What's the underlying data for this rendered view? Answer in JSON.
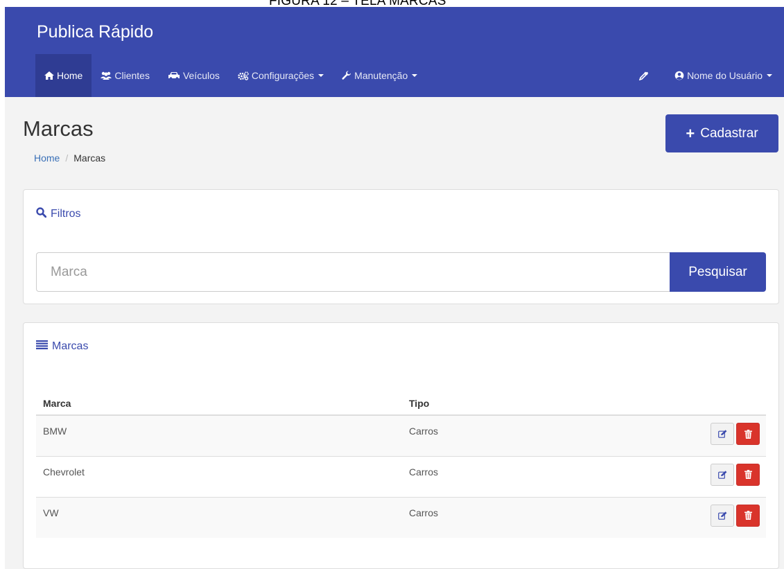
{
  "caption": "FIGURA 12 – TELA MARCAS",
  "app": {
    "brand": "Publica Rápido"
  },
  "nav": {
    "home": "Home",
    "clientes": "Clientes",
    "veiculos": "Veículos",
    "configuracoes": "Configurações",
    "manutencao": "Manutenção",
    "user": "Nome do Usuário"
  },
  "page": {
    "title": "Marcas",
    "breadcrumb": [
      "Home",
      "Marcas"
    ],
    "cadastrar_label": "Cadastrar"
  },
  "filtros": {
    "title": "Filtros",
    "search_placeholder": "Marca",
    "search_button": "Pesquisar"
  },
  "marcas": {
    "title": "Marcas",
    "columns": [
      "Marca",
      "Tipo"
    ],
    "rows": [
      {
        "marca": "BMW",
        "tipo": "Carros"
      },
      {
        "marca": "Chevrolet",
        "tipo": "Carros"
      },
      {
        "marca": "VW",
        "tipo": "Carros"
      }
    ]
  },
  "colors": {
    "primary": "#3a4aad",
    "nav_active": "#2f3c93",
    "danger": "#d9342b",
    "page_bg": "#f3f3f3"
  }
}
